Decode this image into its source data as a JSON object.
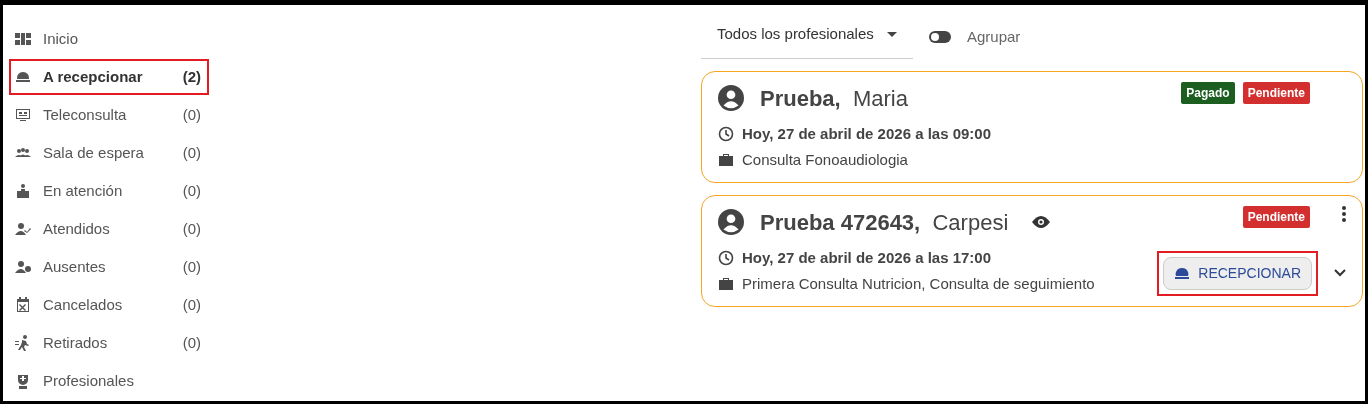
{
  "sidebar": {
    "items": [
      {
        "kind": "home",
        "label": "Inicio",
        "selected": false,
        "highlighted": false
      },
      {
        "kind": "bell",
        "label": "A recepcionar",
        "count": "(2)",
        "selected": true,
        "highlighted": true
      },
      {
        "kind": "video",
        "label": "Teleconsulta",
        "count": "(0)",
        "selected": false,
        "highlighted": false
      },
      {
        "kind": "group",
        "label": "Sala de espera",
        "count": "(0)",
        "selected": false,
        "highlighted": false
      },
      {
        "kind": "desk",
        "label": "En atención",
        "count": "(0)",
        "selected": false,
        "highlighted": false
      },
      {
        "kind": "check",
        "label": "Atendidos",
        "count": "(0)",
        "selected": false,
        "highlighted": false
      },
      {
        "kind": "absent",
        "label": "Ausentes",
        "count": "(0)",
        "selected": false,
        "highlighted": false
      },
      {
        "kind": "calendar",
        "label": "Cancelados",
        "count": "(0)",
        "selected": false,
        "highlighted": false
      },
      {
        "kind": "run",
        "label": "Retirados",
        "count": "(0)",
        "selected": false,
        "highlighted": false
      },
      {
        "kind": "doctor",
        "label": "Profesionales",
        "selected": false,
        "highlighted": false
      }
    ]
  },
  "filter": {
    "professional": "Todos los profesionales",
    "group_toggle": {
      "label": "Agrupar",
      "on": false
    }
  },
  "appointments": [
    {
      "last_name": "Prueba,",
      "first_name": "Maria",
      "viewable": false,
      "badges": [
        {
          "kind": "paid",
          "label": "Pagado"
        },
        {
          "kind": "pending",
          "label": "Pendiente"
        }
      ],
      "datetime": "Hoy, 27 de abril de 2026 a las 09:00",
      "services": "Consulta Fonoaudiologia",
      "actions": false
    },
    {
      "last_name": "Prueba 472643,",
      "first_name": "Carpesi",
      "viewable": true,
      "badges": [
        {
          "kind": "pending",
          "label": "Pendiente"
        }
      ],
      "datetime": "Hoy, 27 de abril de 2026 a las 17:00",
      "services": "Primera Consulta Nutricion, Consulta de seguimiento",
      "actions": true,
      "receive_button": {
        "label": "RECEPCIONAR",
        "highlighted": true
      }
    }
  ]
}
